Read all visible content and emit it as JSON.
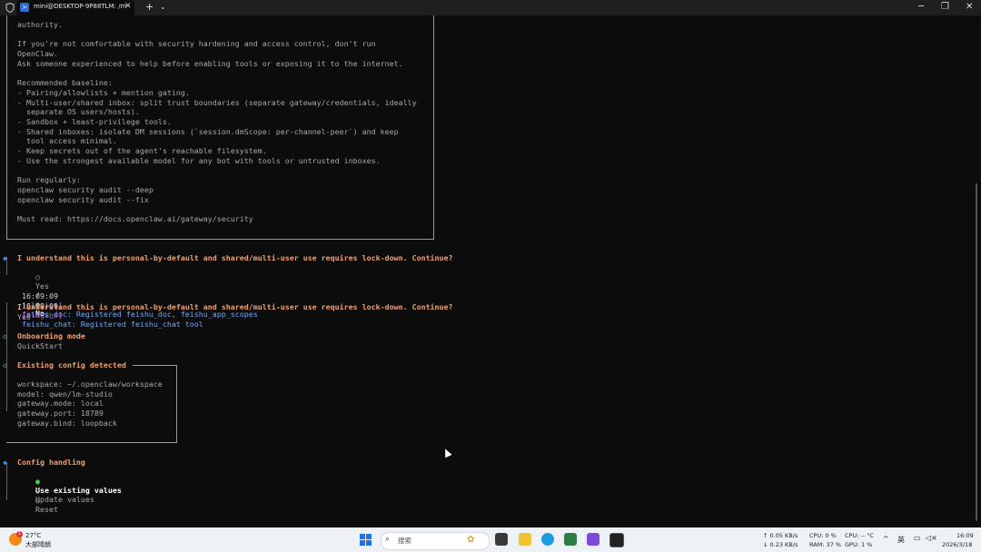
{
  "titlebar": {
    "tab_title": "mini@DESKTOP-9P88TLM: /m",
    "tab_close": "✕",
    "new_tab": "+",
    "dropdown": "⌄",
    "minimize": "─",
    "maximize": "❐",
    "close": "✕"
  },
  "terminal": {
    "security_box": {
      "lines": [
        "authority.",
        "",
        "If you're not comfortable with security hardening and access control, don't run",
        "OpenClaw.",
        "Ask someone experienced to help before enabling tools or exposing it to the internet.",
        "",
        "Recommended baseline:",
        "- Pairing/allowlists + mention gating.",
        "- Multi-user/shared inbox: split trust boundaries (separate gateway/credentials, ideally",
        "  separate OS users/hosts).",
        "- Sandbox + least-privilege tools.",
        "- Shared inboxes: isolate DM sessions (`session.dmScope: per-channel-peer`) and keep",
        "  tool access minimal.",
        "- Keep secrets out of the agent's reachable filesystem.",
        "- Use the strongest available model for any bot with tools or untrusted inboxes.",
        "",
        "Run regularly:",
        "openclaw security audit --deep",
        "openclaw security audit --fix",
        "",
        "Must read: https://docs.openclaw.ai/gateway/security"
      ]
    },
    "prompt1": {
      "question": "I understand this is personal-by-default and shared/multi-user use requires lock-down. Continue?",
      "opt_yes": "Yes",
      "sep": "/",
      "opt_no": "No"
    },
    "log1": {
      "time": "16:09:09",
      "tag": "[plugins]",
      "msg": "feishu_doc: Registered feishu_doc, feishu_app_scopes"
    },
    "log2": {
      "time": "16:09:09",
      "tag": "[plugins]",
      "msg": "feishu_chat: Registered feishu_chat tool"
    },
    "prompt2": {
      "question": "I understand this is personal-by-default and shared/multi-user use requires lock-down. Continue?",
      "answer": "Yes"
    },
    "onboarding": {
      "title": "Onboarding mode",
      "value": "QuickStart"
    },
    "existing_config": {
      "title": "Existing config detected",
      "lines": [
        "workspace: ~/.openclaw/workspace",
        "model: qwen/lm-studio",
        "gateway.mode: local",
        "gateway.port: 18789",
        "gateway.bind: loopback"
      ]
    },
    "config_handling": {
      "title": "Config handling",
      "options": [
        "Use existing values",
        "Update values",
        "Reset"
      ]
    },
    "glyphs": {
      "diamond": "◆",
      "diamond_open": "◇",
      "radio_on": "●",
      "radio_off": "○"
    }
  },
  "taskbar": {
    "weather_temp": "27°C",
    "weather_desc": "大部晴朗",
    "weather_badge": "1",
    "search_placeholder": "搜索",
    "net_up": "↑ 0.05 KB/s",
    "net_down": "↓ 0.23 KB/s",
    "cpu_usage": "CPU: 0 %",
    "cpu_temp": "CPU: -- °C",
    "ram": "RAM: 37 %",
    "gpu": "GPU: 1 %",
    "ime": "英",
    "time": "16:09",
    "date": "2026/3/18"
  },
  "colors": {
    "accent_orange": "#f0a070",
    "accent_blue": "#6fa8ff",
    "accent_purple": "#b070d8",
    "accent_green": "#39d353",
    "background": "#0c0c0c"
  }
}
